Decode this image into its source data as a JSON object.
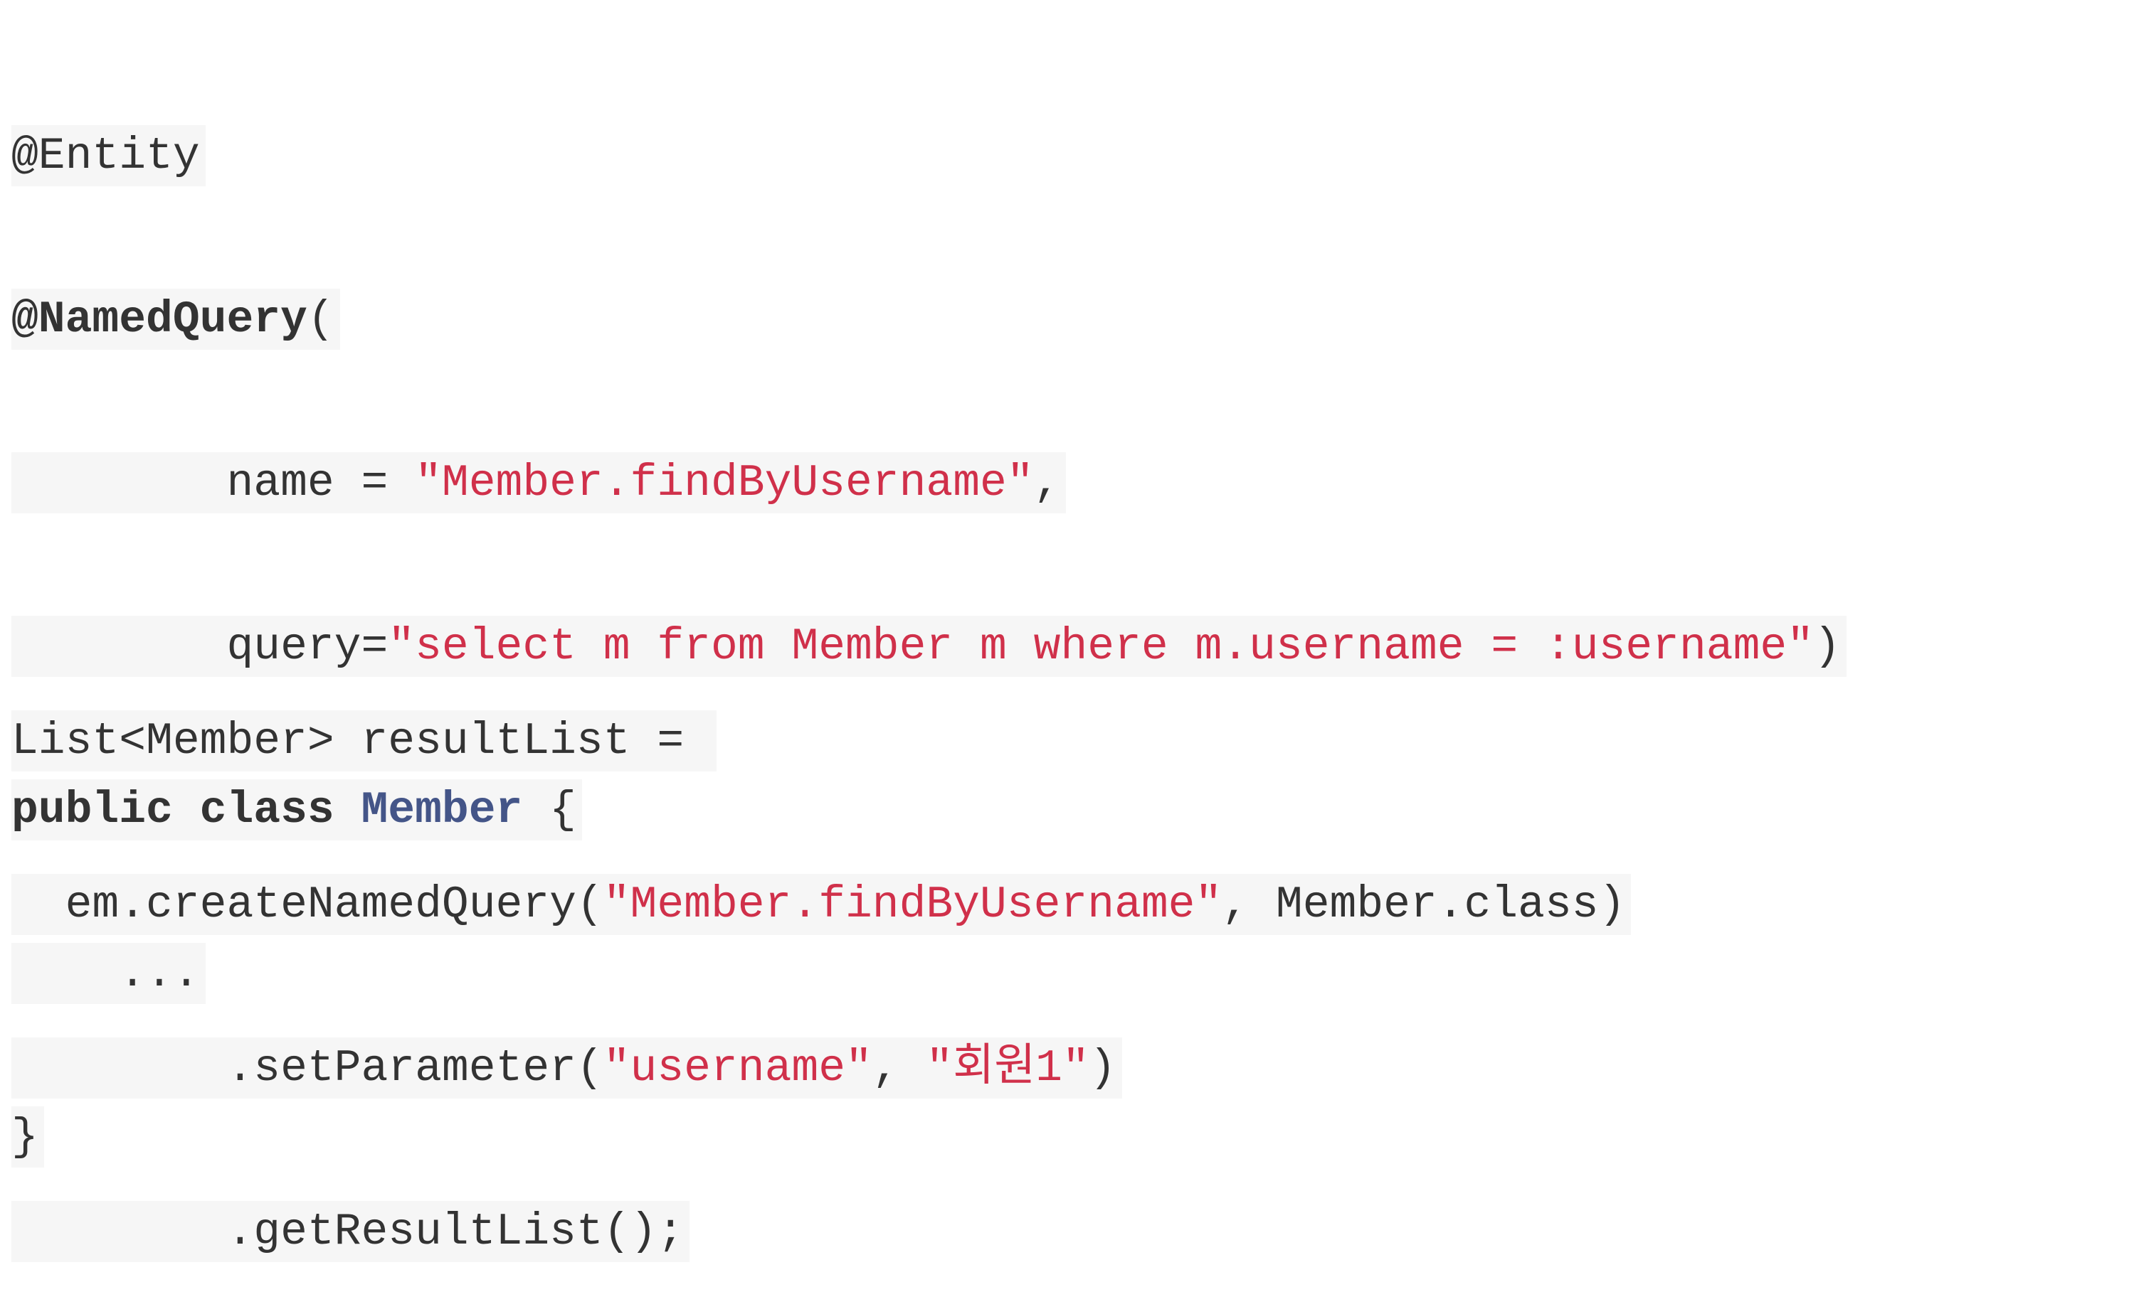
{
  "colors": {
    "background": "#ffffff",
    "code_background": "#f6f6f6",
    "text": "#333333",
    "string": "#d0304a",
    "class_name": "#445588"
  },
  "code_block_1": {
    "line_1": {
      "text": "@Entity"
    },
    "line_2": {
      "annotation": "@NamedQuery",
      "paren": "("
    },
    "line_3": {
      "indent": "        ",
      "key": "name = ",
      "value": "\"Member.findByUsername\"",
      "trail": ","
    },
    "line_4": {
      "indent": "        ",
      "key": "query=",
      "value": "\"select m from Member m where m.username = :username\"",
      "trail": ")"
    },
    "line_5": {
      "kw_public": "public",
      "kw_class": "class",
      "class_name": "Member",
      "brace": "{"
    },
    "line_6": {
      "text": "    ..."
    },
    "line_7": {
      "text": "}"
    }
  },
  "code_block_2": {
    "line_1": {
      "text": "List<Member> resultList = "
    },
    "line_2": {
      "indent": "  ",
      "call": "em.createNamedQuery(",
      "arg_1": "\"Member.findByUsername\"",
      "rest": ", Member.class)"
    },
    "line_3": {
      "indent": "        ",
      "call": ".setParameter(",
      "arg_1": "\"username\"",
      "sep": ", ",
      "arg_2": "\"회원1\"",
      "close": ")"
    },
    "line_4": {
      "indent": "        ",
      "text": ".getResultList();"
    }
  }
}
